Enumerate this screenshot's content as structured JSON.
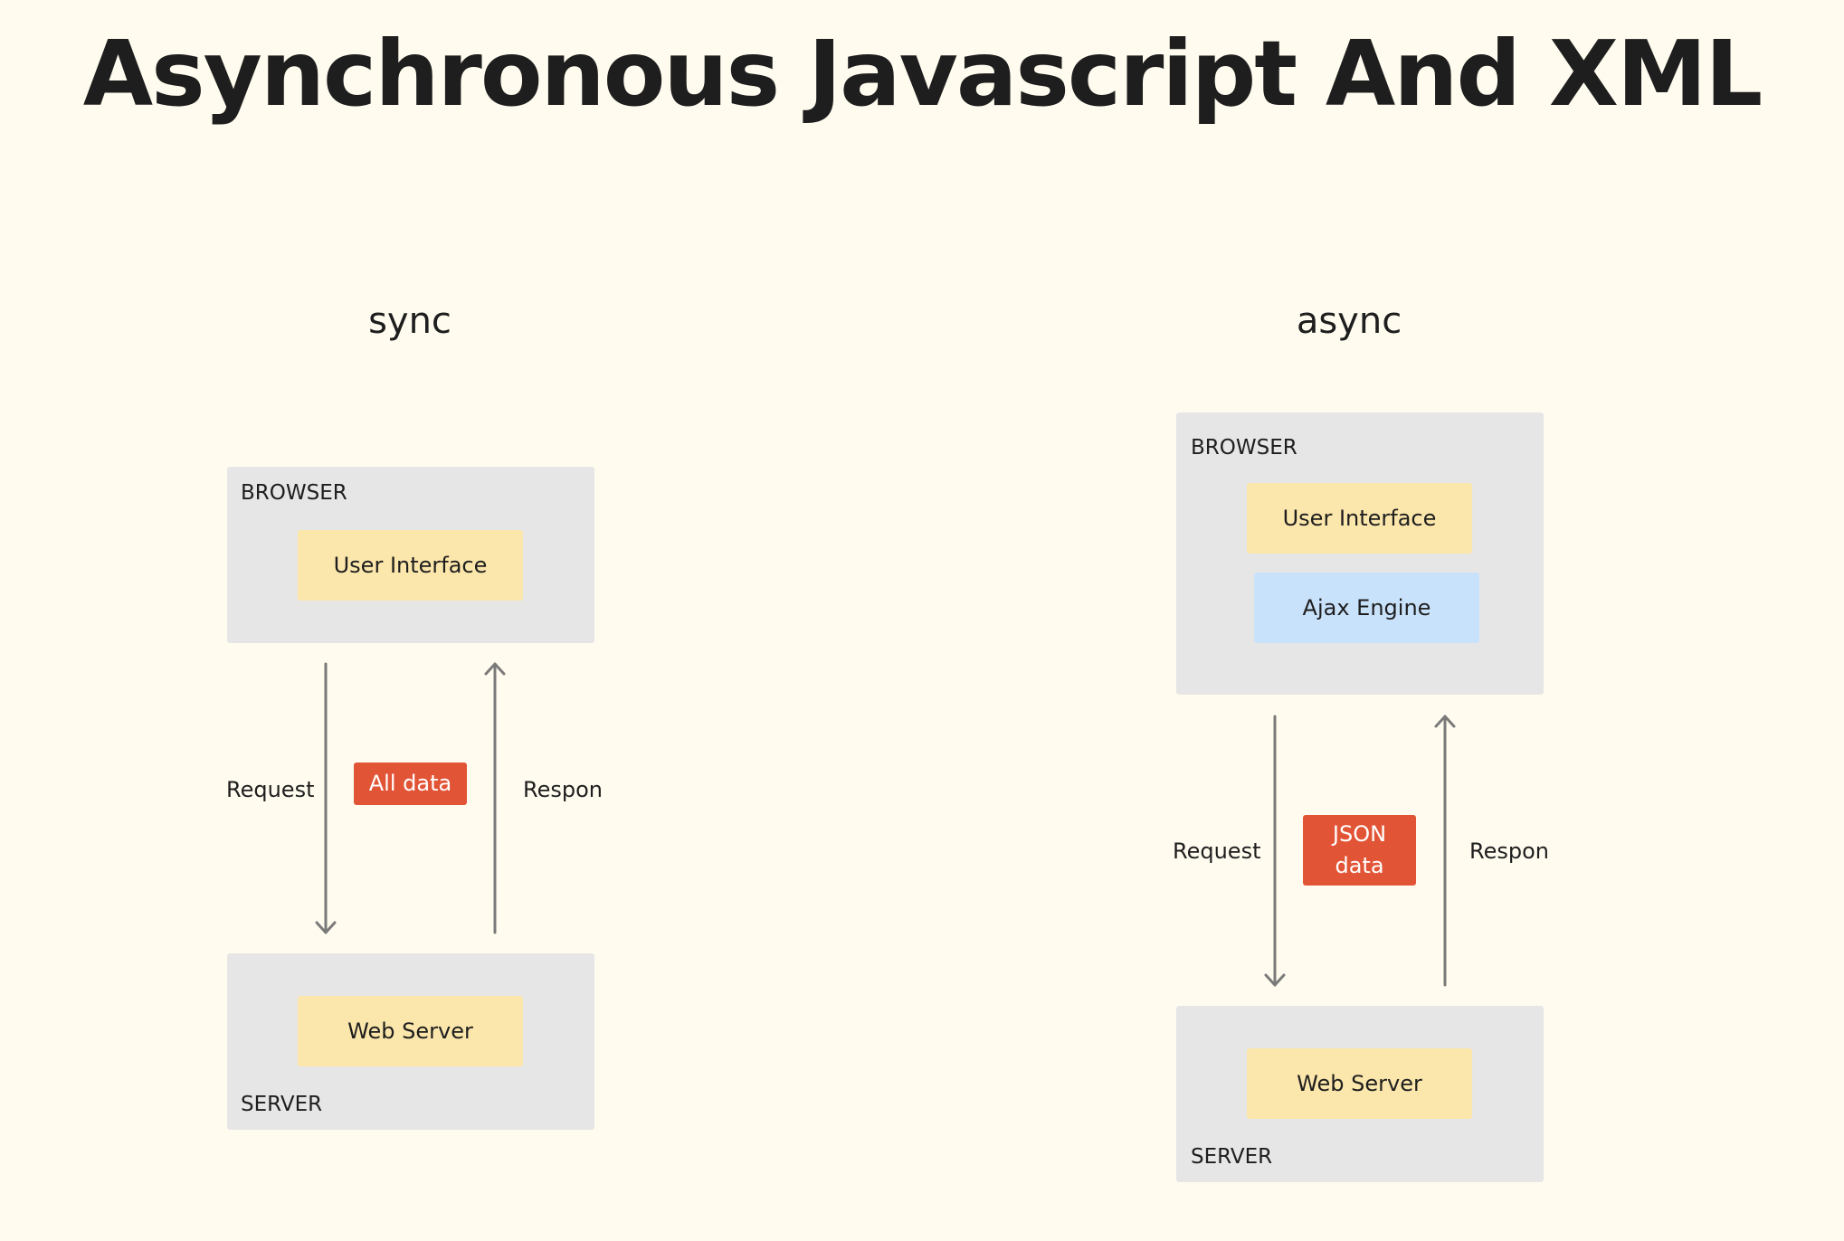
{
  "title": "Asynchronous Javascript And XML",
  "sync": {
    "heading": "sync",
    "browser": {
      "label": "BROWSER",
      "components": [
        "User Interface"
      ]
    },
    "server": {
      "label": "SERVER",
      "components": [
        "Web Server"
      ]
    },
    "request_label": "Request",
    "response_label": "Respon",
    "payload": "All data"
  },
  "async": {
    "heading": "async",
    "browser": {
      "label": "BROWSER",
      "components": [
        "User Interface",
        "Ajax Engine"
      ]
    },
    "server": {
      "label": "SERVER",
      "components": [
        "Web Server"
      ]
    },
    "request_label": "Request",
    "response_label": "Respon",
    "payload_line1": "JSON",
    "payload_line2": "data"
  },
  "colors": {
    "background": "#fffcef",
    "container": "#e6e6e6",
    "component": "#fbe6ab",
    "engine": "#c9e2fb",
    "payload": "#e25436",
    "arrow": "#7a7a7a",
    "text": "#1e1e1e"
  }
}
